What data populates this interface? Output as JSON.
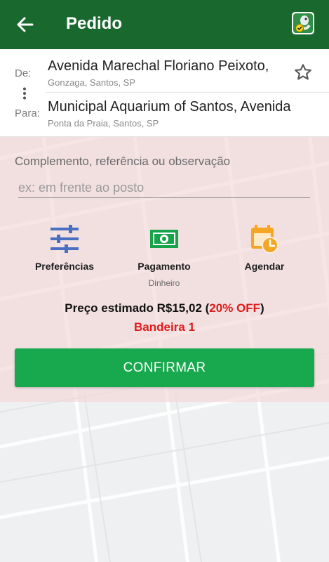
{
  "header": {
    "title": "Pedido",
    "back_icon": "arrow-left-icon",
    "logo_icon": "app-logo-icon",
    "bar_color": "#19692f"
  },
  "route": {
    "from_label": "De:",
    "from_address": "Avenida Marechal Floriano Peixoto,",
    "from_subtitle": "Gonzaga, Santos, SP",
    "to_label": "Para:",
    "to_address": "Municipal Aquarium of Santos, Avenida",
    "to_subtitle": "Ponta da Praia, Santos, SP",
    "more_icon": "more-vertical-icon",
    "favorite_icon": "star-outline-icon"
  },
  "complement": {
    "label": "Complemento, referência ou observação",
    "placeholder": "ex: em frente ao posto",
    "value": ""
  },
  "options": [
    {
      "label": "Preferências",
      "icon": "sliders-icon",
      "sub": ""
    },
    {
      "label": "Pagamento",
      "icon": "cash-icon",
      "sub": "Dinheiro"
    },
    {
      "label": "Agendar",
      "icon": "calendar-clock-icon",
      "sub": ""
    }
  ],
  "price": {
    "prefix": "Preço estimado R$15,02 (",
    "discount": "20% OFF",
    "suffix": ")",
    "bandeira": "Bandeira 1"
  },
  "confirm_label": "CONFIRMAR",
  "colors": {
    "accent_green": "#18a84d",
    "header_green": "#19692f",
    "discount_red": "#e01b1b",
    "icon_blue": "#4a6fc1",
    "icon_orange": "#f5a623"
  }
}
